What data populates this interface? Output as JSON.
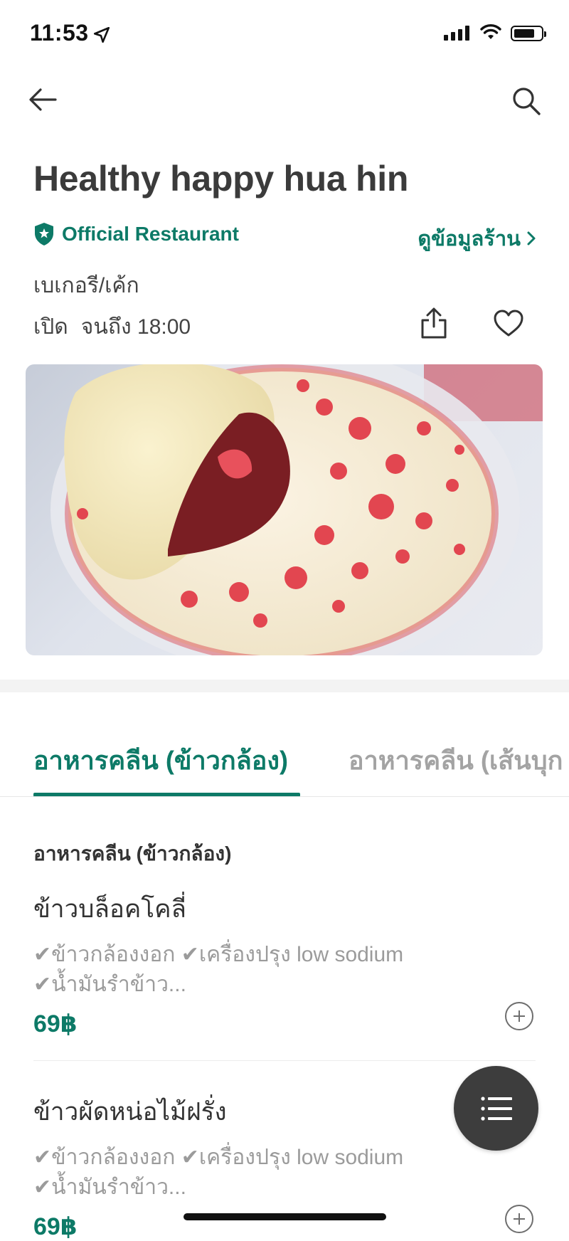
{
  "status_bar": {
    "time": "11:53"
  },
  "restaurant": {
    "name": "Healthy happy hua hin",
    "badge": "Official Restaurant",
    "info_link": "ดูข้อมูลร้าน",
    "category": "เบเกอรี/เค้ก",
    "open_label": "เปิด",
    "hours": "จนถึง 18:00"
  },
  "tabs": [
    {
      "label": "อาหารคลีน (ข้าวกล้อง)",
      "active": true
    },
    {
      "label": "อาหารคลีน (เส้นบุก",
      "active": false
    }
  ],
  "section": {
    "title": "อาหารคลีน (ข้าวกล้อง)"
  },
  "menu_items": [
    {
      "name": "ข้าวบล็อคโคลี่",
      "description": "✔ข้าวกล้องงอก ✔เครื่องปรุง low sodium ✔น้ำมันรำข้าว...",
      "price": "69฿"
    },
    {
      "name": "ข้าวผัดหน่อไม้ฝรั่ง",
      "description": "✔ข้าวกล้องงอก ✔เครื่องปรุง low sodium ✔น้ำมันรำข้าว...",
      "price": "69฿"
    }
  ],
  "icons": {
    "back": "arrow-left-icon",
    "search": "search-icon",
    "badge": "shield-star-icon",
    "share": "share-icon",
    "favorite": "heart-icon",
    "add": "plus-circle-icon",
    "menu": "list-icon"
  },
  "colors": {
    "accent": "#0d7a67",
    "fab": "#3d3d3d"
  }
}
